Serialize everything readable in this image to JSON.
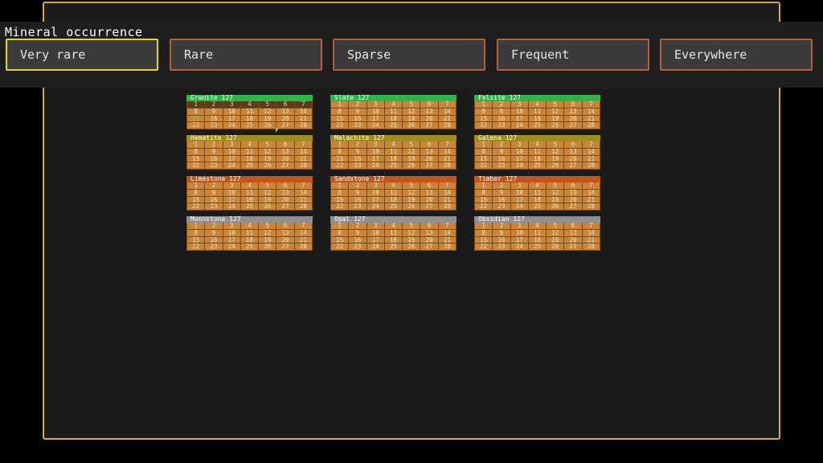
{
  "title": "Mineral occurrence",
  "options": [
    {
      "label": "Very rare",
      "selected": true
    },
    {
      "label": "Rare",
      "selected": false
    },
    {
      "label": "Sparse",
      "selected": false
    },
    {
      "label": "Frequent",
      "selected": false
    },
    {
      "label": "Everywhere",
      "selected": false
    }
  ],
  "cards": [
    {
      "name": "Granite 127",
      "color": "#2fb34a"
    },
    {
      "name": "Slate 127",
      "color": "#2fb34a"
    },
    {
      "name": "Felsite 127",
      "color": "#2fb34a"
    },
    {
      "name": "Hematite 127",
      "color": "#9c8d1e"
    },
    {
      "name": "Malachite 127",
      "color": "#9c8d1e"
    },
    {
      "name": "Galena 127",
      "color": "#9c8d1e"
    },
    {
      "name": "Limestone 127",
      "color": "#c2561a"
    },
    {
      "name": "Sandstone 127",
      "color": "#c2561a"
    },
    {
      "name": "Timber 127",
      "color": "#c2561a"
    },
    {
      "name": "Moonstone 127",
      "color": "#8f8f8f"
    },
    {
      "name": "Opal 127",
      "color": "#8f8f8f"
    },
    {
      "name": "Obsidian 127",
      "color": "#8f8f8f"
    }
  ],
  "days": [
    "1",
    "2",
    "3",
    "4",
    "5",
    "6",
    "7",
    "8",
    "9",
    "10",
    "11",
    "12",
    "13",
    "14",
    "15",
    "16",
    "17",
    "18",
    "19",
    "20",
    "21",
    "22",
    "23",
    "24",
    "25",
    "26",
    "27",
    "28"
  ],
  "granite_marked_day": "15"
}
